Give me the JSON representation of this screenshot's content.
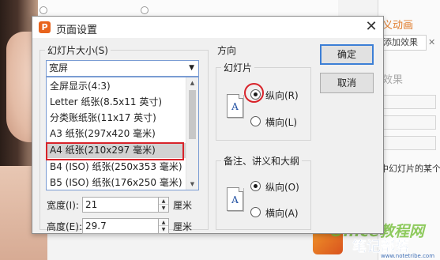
{
  "background": {
    "animation_title": "义动画",
    "add_effect_label": "添加效果",
    "effect_label": "效果",
    "slide_text": "中幻灯片的某个"
  },
  "watermark": {
    "office_text": "Office教程网",
    "brand_text": "笔记部落",
    "url_text": "www.notetribe.com"
  },
  "dialog": {
    "title": "页面设置",
    "close_glyph": "✕",
    "slide_size": {
      "label": "幻灯片大小(S)",
      "selected": "宽屏",
      "options": [
        "全屏显示(4:3)",
        "Letter 纸张(8.5x11 英寸)",
        "分类账纸张(11x17 英寸)",
        "A3 纸张(297x420 毫米)",
        "A4 纸张(210x297 毫米)",
        "B4 (ISO) 纸张(250x353 毫米)",
        "B5 (ISO) 纸张(176x250 毫米)"
      ],
      "highlighted_index": 4,
      "width_label": "宽度(I):",
      "width_value": "21",
      "height_label": "高度(E):",
      "height_value": "29.7",
      "unit": "厘米"
    },
    "orientation": {
      "label": "方向",
      "slides": {
        "label": "幻灯片",
        "portrait": "纵向(R)",
        "landscape": "横向(L)",
        "selected": "portrait"
      },
      "notes": {
        "label": "备注、讲义和大纲",
        "portrait": "纵向(O)",
        "landscape": "横向(A)",
        "selected": "portrait"
      },
      "page_letter": "A"
    },
    "buttons": {
      "ok": "确定",
      "cancel": "取消"
    }
  },
  "colors": {
    "highlight_red": "#d8232a",
    "title_icon": "#e8641d",
    "accent_orange": "#e07b2a",
    "focus_blue": "#3c7fd6"
  }
}
